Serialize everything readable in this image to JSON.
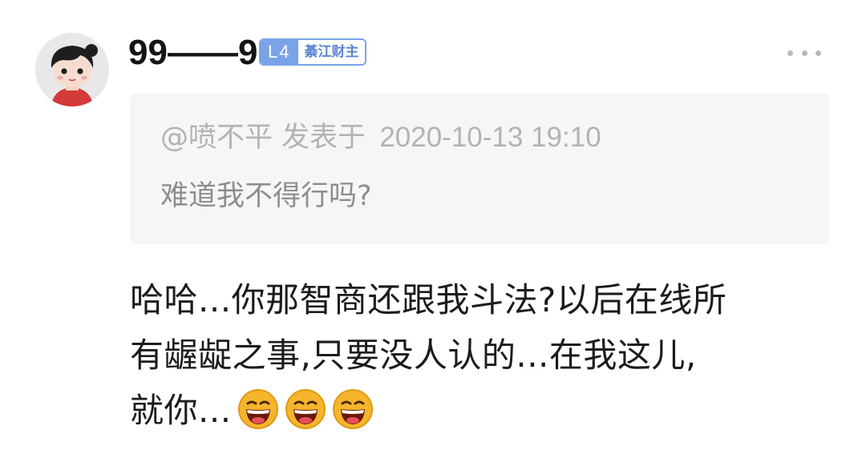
{
  "user": {
    "name": "99——9",
    "level": "L4",
    "title": "綦江财主"
  },
  "quote": {
    "author": "@喷不平",
    "verb": "发表于",
    "date": "2020-10-13 19:10",
    "text": "难道我不得行吗?"
  },
  "comment": {
    "lines": [
      "哈哈...你那智商还跟我斗法?以后在线所",
      "有龌龊之事,只要没人认的...在我这儿,",
      "就你..."
    ],
    "emojis": [
      "laughing-face-icon",
      "laughing-face-icon",
      "laughing-face-icon"
    ]
  },
  "colors": {
    "level_badge": "#79a3e6",
    "quote_background": "#f6f6f6",
    "quote_text": "#b3b3b3",
    "emoji_face": "#f5b52c"
  }
}
